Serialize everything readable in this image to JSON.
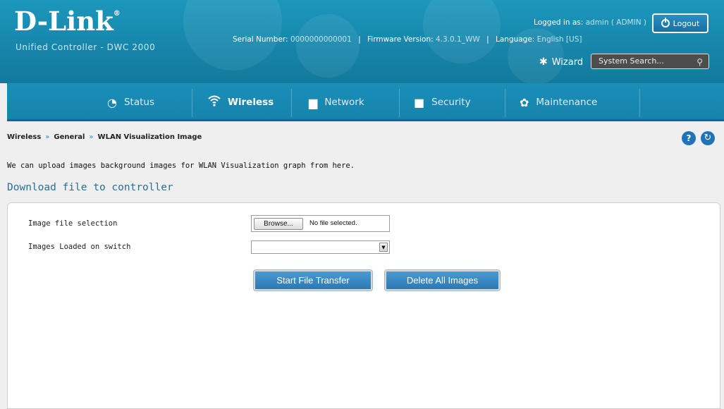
{
  "header": {
    "logo_text": "D-Link",
    "logo_registered": "®",
    "product": "Unified Controller - DWC 2000",
    "serial_label": "Serial Number:",
    "serial_value": "0000000000001",
    "firmware_label": "Firmware Version:",
    "firmware_value": "4.3.0.1_WW",
    "language_label": "Language:",
    "language_value": "English [US]",
    "logged_in_label": "Logged in as:",
    "logged_in_value": "admin ( ADMIN )",
    "logout_label": "Logout",
    "wizard_label": "Wizard",
    "search_placeholder": "System Search..."
  },
  "nav": {
    "items": [
      {
        "label": "Status",
        "icon": "gauge-icon"
      },
      {
        "label": "Wireless",
        "icon": "wifi-icon"
      },
      {
        "label": "Network",
        "icon": "monitor-icon"
      },
      {
        "label": "Security",
        "icon": "lock-icon"
      },
      {
        "label": "Maintenance",
        "icon": "gears-icon"
      }
    ],
    "active": "Wireless"
  },
  "breadcrumb": [
    "Wireless",
    "General",
    "WLAN Visualization Image"
  ],
  "breadcrumb_sep": "»",
  "description": "We can upload images background images for WLAN Visualization graph from here.",
  "section_title": "Download file to controller",
  "form": {
    "image_file_label": "Image file selection",
    "browse_label": "Browse...",
    "file_status": "No file selected.",
    "images_loaded_label": "Images Loaded on switch",
    "images_loaded_value": "",
    "start_transfer_label": "Start File Transfer",
    "delete_all_label": "Delete All Images"
  },
  "colors": {
    "header_blue": "#1786ab",
    "link_blue": "#2a6f96",
    "button_blue": "#2b79b5"
  }
}
